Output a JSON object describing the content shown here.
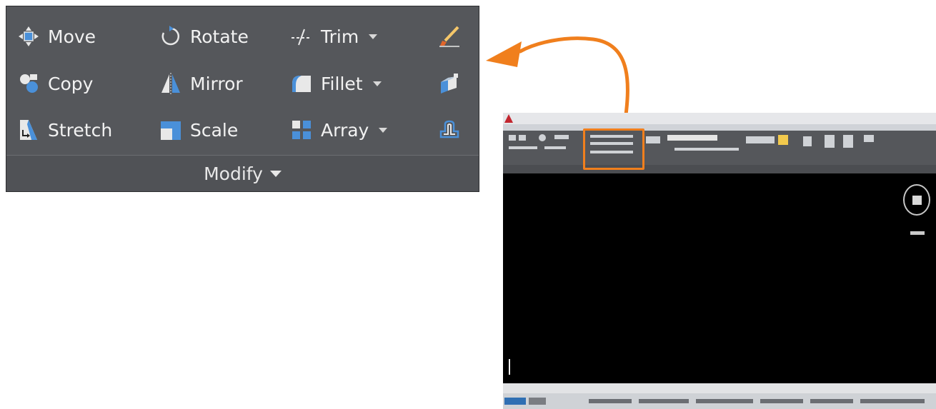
{
  "panel": {
    "title": "Modify",
    "rows": [
      [
        {
          "label": "Move",
          "icon": "move-icon",
          "dropdown": false
        },
        {
          "label": "Rotate",
          "icon": "rotate-icon",
          "dropdown": false
        },
        {
          "label": "Trim",
          "icon": "trim-icon",
          "dropdown": true
        },
        {
          "label": "",
          "icon": "erase-icon",
          "dropdown": false
        }
      ],
      [
        {
          "label": "Copy",
          "icon": "copy-icon",
          "dropdown": false
        },
        {
          "label": "Mirror",
          "icon": "mirror-icon",
          "dropdown": false
        },
        {
          "label": "Fillet",
          "icon": "fillet-icon",
          "dropdown": true
        },
        {
          "label": "",
          "icon": "explode-icon",
          "dropdown": false
        }
      ],
      [
        {
          "label": "Stretch",
          "icon": "stretch-icon",
          "dropdown": false
        },
        {
          "label": "Scale",
          "icon": "scale-icon",
          "dropdown": false
        },
        {
          "label": "Array",
          "icon": "array-icon",
          "dropdown": true
        },
        {
          "label": "",
          "icon": "offset-icon",
          "dropdown": false
        }
      ]
    ]
  },
  "colors": {
    "panel_bg": "#55575b",
    "highlight": "#f07f1d",
    "text": "#f2f2f2"
  }
}
